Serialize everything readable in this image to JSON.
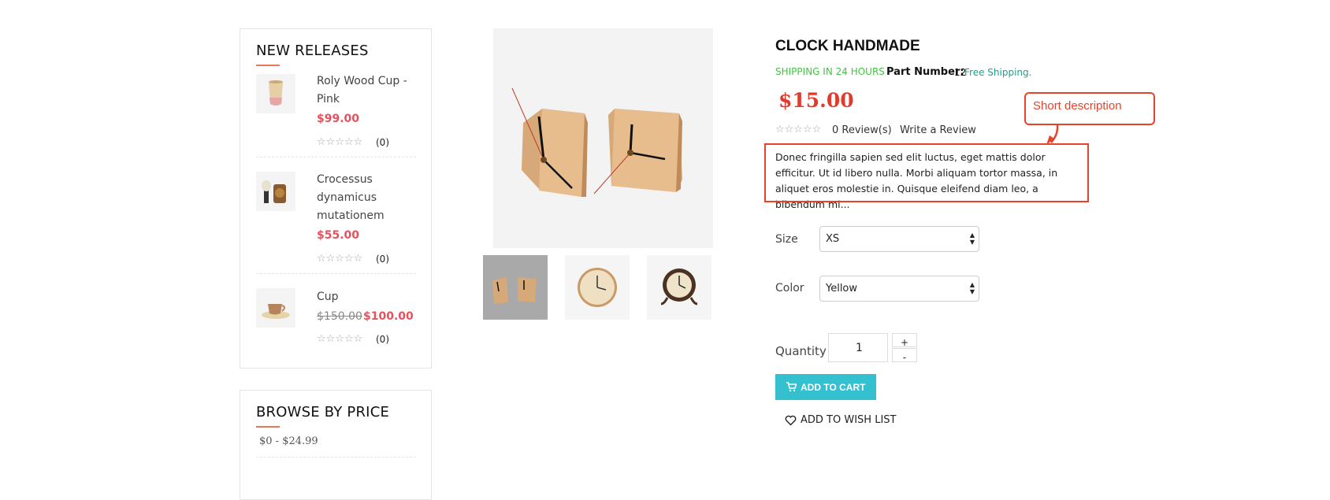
{
  "sidebar": {
    "new_releases": {
      "title": "NEW RELEASES",
      "items": [
        {
          "name": "Roly Wood Cup - Pink",
          "price": "$99.00",
          "old_price": "",
          "stars": "☆☆☆☆☆",
          "reviews": "(0)"
        },
        {
          "name": "Crocessus dynamicus mutationem",
          "price": "$55.00",
          "old_price": "",
          "stars": "☆☆☆☆☆",
          "reviews": "(0)"
        },
        {
          "name": "Cup",
          "price": "$100.00",
          "old_price": "$150.00",
          "stars": "☆☆☆☆☆",
          "reviews": "(0)"
        }
      ]
    },
    "browse_by_price": {
      "title": "BROWSE BY PRICE",
      "ranges": [
        "$0 - $24.99"
      ]
    }
  },
  "product": {
    "title": "CLOCK HANDMADE",
    "shipping": "SHIPPING IN 24 HOURS",
    "part_label": "Part Number:",
    "part_value": "12",
    "free_shipping": "Free Shipping.",
    "price": "$15.00",
    "stars": "☆☆☆☆☆",
    "reviews": "0 Review(s)",
    "write_review": "Write a Review",
    "description": "Donec fringilla sapien sed elit luctus, eget mattis dolor efficitur. Ut id libero nulla. Morbi aliquam tortor massa, in aliquet eros molestie in. Quisque eleifend diam leo, a bibendum mi...",
    "size_label": "Size",
    "size_value": "XS",
    "color_label": "Color",
    "color_value": "Yellow",
    "quantity_label": "Quantity",
    "quantity_value": "1",
    "qty_plus": "+",
    "qty_minus": "-",
    "add_to_cart": "ADD TO CART",
    "add_to_wishlist": "ADD TO WISH LIST"
  },
  "annotation": {
    "label": "Short description"
  },
  "colors": {
    "accent": "#35c0d0",
    "price_red": "#e8505b",
    "product_price": "#e03c2e",
    "shipping_green": "#46c346",
    "free_shipping_teal": "#1aa38a",
    "annotation_red": "#e8432a"
  }
}
